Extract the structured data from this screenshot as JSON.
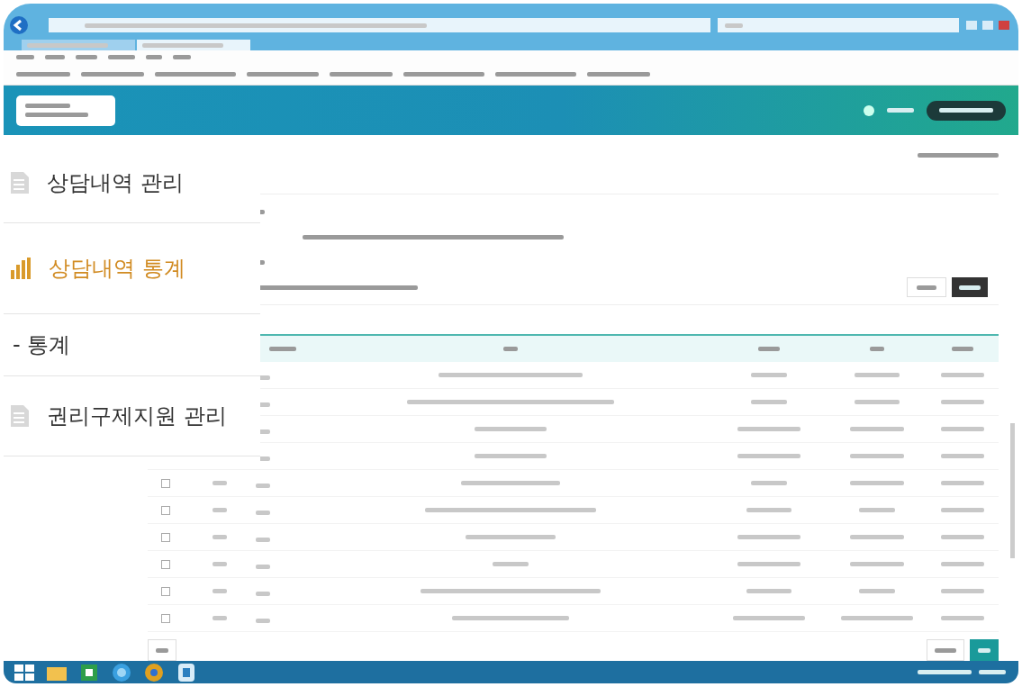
{
  "menu": [
    {
      "label": "상담내역 관리",
      "kind": "document",
      "selected": false
    },
    {
      "label": "상담내역 통계",
      "kind": "chart",
      "selected": true
    },
    {
      "label": "- 통계",
      "kind": "sub",
      "selected": false
    },
    {
      "label": "권리구제지원 관리",
      "kind": "document",
      "selected": false
    }
  ],
  "table": {
    "row_checkboxes": [
      {
        "checked": false
      },
      {
        "checked": false
      },
      {
        "checked": false
      },
      {
        "checked": false
      },
      {
        "checked": false
      },
      {
        "checked": false
      }
    ]
  }
}
